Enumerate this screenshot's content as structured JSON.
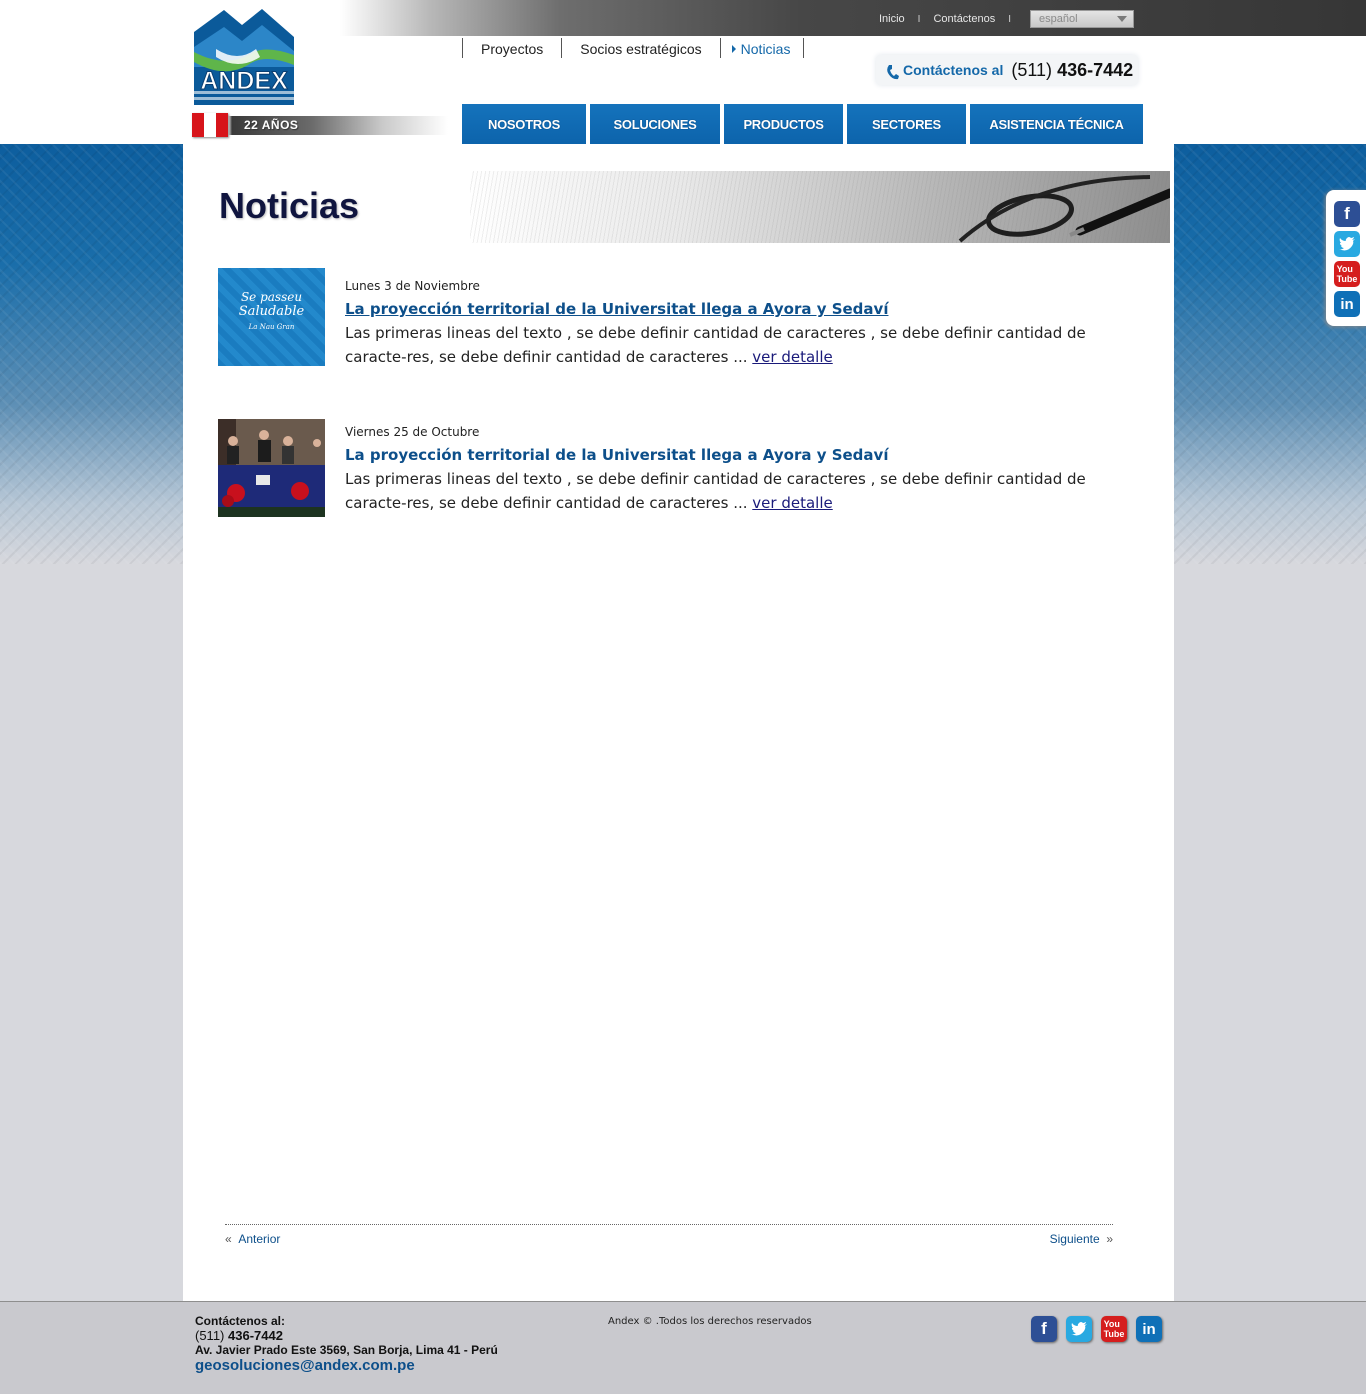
{
  "header": {
    "top_links": [
      "Inicio",
      "Contáctenos"
    ],
    "language": "español",
    "brand": "ANDEX",
    "years": "22 AÑOS",
    "secondary_nav": [
      {
        "label": "Proyectos",
        "active": false
      },
      {
        "label": "Socios estratégicos",
        "active": false
      },
      {
        "label": "Noticias",
        "active": true
      }
    ],
    "contact": {
      "label": "Contáctenos al",
      "area": "(511)",
      "number": "436-7442"
    },
    "main_nav": [
      "NOSOTROS",
      "SOLUCIONES",
      "PRODUCTOS",
      "SECTORES",
      "ASISTENCIA TÉCNICA"
    ]
  },
  "page": {
    "title": "Noticias",
    "news": [
      {
        "date": "Lunes 3 de Noviembre",
        "title": "La proyección territorial de la Universitat llega a Ayora y Sedaví",
        "text": "Las primeras lineas del texto , se debe definir cantidad de caracteres , se debe definir cantidad de caracte-res, se debe definir cantidad de caracteres ...",
        "link": "ver detalle",
        "thumb_text": [
          "Se passeu",
          "Saludable",
          "La Nau Gran"
        ]
      },
      {
        "date": "Viernes 25 de Octubre",
        "title": "La proyección territorial de la Universitat llega a Ayora y Sedaví",
        "text": "Las primeras lineas del texto , se debe definir cantidad de caracteres , se debe definir cantidad de caracte-res, se debe definir cantidad de caracteres ...",
        "link": "ver detalle"
      }
    ],
    "pager": {
      "prev": "Anterior",
      "next": "Siguiente"
    }
  },
  "social": [
    "facebook-icon",
    "twitter-icon",
    "youtube-icon",
    "linkedin-icon"
  ],
  "footer": {
    "contact_label": "Contáctenos al:",
    "phone_area": "(511)",
    "phone_number": "436-7442",
    "address": "Av. Javier Prado Este 3569, San Borja, Lima 41 - Perú",
    "email": "geosoluciones@andex.com.pe",
    "copyright": "Andex © .Todos los derechos reservados"
  },
  "colors": {
    "brand_blue": "#0c63ab",
    "title_navy": "#10153f",
    "link_blue": "#0d4f8a"
  }
}
